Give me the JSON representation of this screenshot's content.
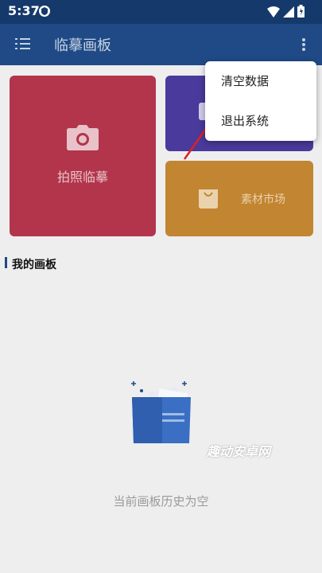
{
  "status": {
    "time": "5:37",
    "icons": [
      "shield-icon",
      "wifi-icon",
      "signal-icon",
      "battery-icon"
    ]
  },
  "appbar": {
    "title": "临摹画板",
    "menu_icon": "hamburger-menu-icon",
    "more_icon": "more-vert-icon"
  },
  "tiles": {
    "photo": {
      "label": "拍照临摹",
      "icon": "camera-icon",
      "color": "#b2354b"
    },
    "purple": {
      "icon": "image-icon",
      "color": "#4a3a9b"
    },
    "market": {
      "label": "素材市场",
      "icon": "bag-icon",
      "color": "#c28531"
    }
  },
  "section": {
    "title": "我的画板"
  },
  "empty": {
    "text": "当前画板历史为空",
    "icon": "empty-folder-icon"
  },
  "popup": {
    "items": [
      {
        "label": "清空数据"
      },
      {
        "label": "退出系统"
      }
    ]
  },
  "watermark": {
    "text": "趣动安卓网"
  },
  "colors": {
    "appbar": "#1f4a86",
    "statusbar": "#16396b",
    "accent_arrow": "#e02020"
  }
}
